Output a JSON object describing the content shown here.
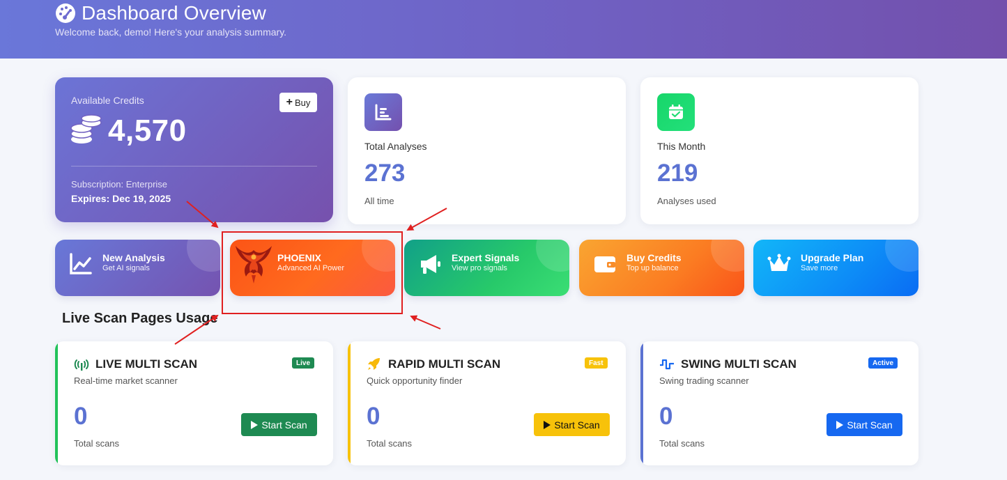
{
  "header": {
    "title": "Dashboard Overview",
    "subtitle": "Welcome back, demo! Here's your analysis summary."
  },
  "credits": {
    "label": "Available Credits",
    "buy_label": "Buy",
    "value": "4,570",
    "subscription": "Subscription: Enterprise",
    "expires": "Expires: Dec 19, 2025"
  },
  "stats": [
    {
      "label": "Total Analyses",
      "value": "273",
      "note": "All time",
      "icon": "chart-bar-icon",
      "color": "#7167d0"
    },
    {
      "label": "This Month",
      "value": "219",
      "note": "Analyses used",
      "icon": "calendar-check-icon",
      "color": "#1ee06e"
    }
  ],
  "actions": [
    {
      "title": "New Analysis",
      "sub": "Get AI signals",
      "icon": "chart-line-icon"
    },
    {
      "title": "PHOENIX",
      "sub": "Advanced AI Power",
      "icon": "phoenix-icon"
    },
    {
      "title": "Expert Signals",
      "sub": "View pro signals",
      "icon": "megaphone-icon"
    },
    {
      "title": "Buy Credits",
      "sub": "Top up balance",
      "icon": "wallet-icon"
    },
    {
      "title": "Upgrade Plan",
      "sub": "Save more",
      "icon": "crown-icon"
    }
  ],
  "section_title": "Live Scan Pages Usage",
  "scans": [
    {
      "title": "LIVE MULTI SCAN",
      "sub": "Real-time market scanner",
      "badge": "Live",
      "count": "0",
      "count_label": "Total scans",
      "button": "Start Scan",
      "color": "#1e8a52",
      "icon": "broadcast-icon"
    },
    {
      "title": "RAPID MULTI SCAN",
      "sub": "Quick opportunity finder",
      "badge": "Fast",
      "count": "0",
      "count_label": "Total scans",
      "button": "Start Scan",
      "color": "#f7c20a",
      "icon": "rocket-icon"
    },
    {
      "title": "SWING MULTI SCAN",
      "sub": "Swing trading scanner",
      "badge": "Active",
      "count": "0",
      "count_label": "Total scans",
      "button": "Start Scan",
      "color": "#1668f0",
      "icon": "wave-square-icon"
    }
  ]
}
